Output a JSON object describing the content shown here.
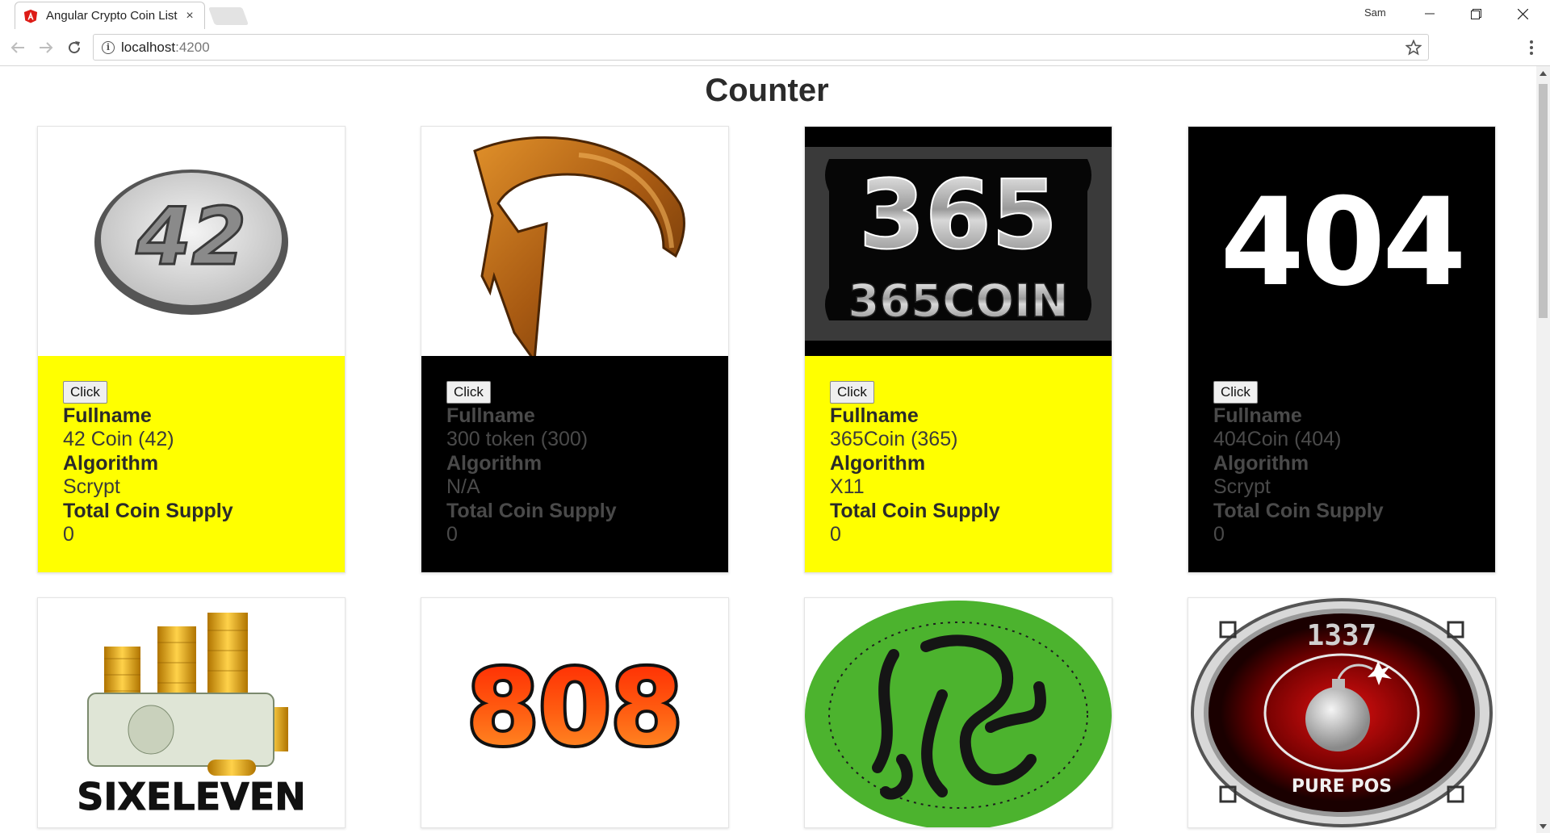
{
  "browser": {
    "tab_title": "Angular Crypto Coin List",
    "tab_close": "×",
    "user_name": "Sam",
    "url_host": "localhost",
    "url_port": ":4200"
  },
  "page": {
    "title": "Counter"
  },
  "cards": [
    {
      "style": "yellow",
      "image_text": "42",
      "button": "Click",
      "fullname_label": "Fullname",
      "fullname": "42 Coin (42)",
      "algorithm_label": "Algorithm",
      "algorithm": "Scrypt",
      "supply_label": "Total Coin Supply",
      "supply": "0"
    },
    {
      "style": "black",
      "image_text": "",
      "button": "Click",
      "fullname_label": "Fullname",
      "fullname": "300 token (300)",
      "algorithm_label": "Algorithm",
      "algorithm": "N/A",
      "supply_label": "Total Coin Supply",
      "supply": "0"
    },
    {
      "style": "yellow",
      "image_text": "365",
      "image_subtext": "365COIN",
      "button": "Click",
      "fullname_label": "Fullname",
      "fullname": "365Coin (365)",
      "algorithm_label": "Algorithm",
      "algorithm": "X11",
      "supply_label": "Total Coin Supply",
      "supply": "0"
    },
    {
      "style": "black",
      "image_text": "404",
      "button": "Click",
      "fullname_label": "Fullname",
      "fullname": "404Coin (404)",
      "algorithm_label": "Algorithm",
      "algorithm": "Scrypt",
      "supply_label": "Total Coin Supply",
      "supply": "0"
    },
    {
      "style": "yellow",
      "image_text": "SIXELEVEN"
    },
    {
      "style": "black",
      "image_text": "808"
    },
    {
      "style": "yellow",
      "image_text": ""
    },
    {
      "style": "black",
      "image_text": "1337",
      "image_subtext": "PURE POS"
    }
  ],
  "colors": {
    "yellow_card": "#ffff00",
    "black_card": "#000000",
    "angular_red": "#dd1b16"
  }
}
